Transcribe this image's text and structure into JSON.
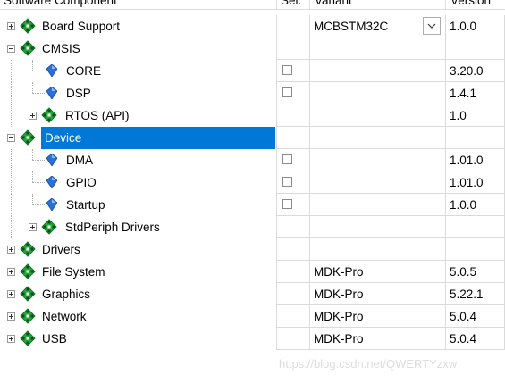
{
  "header": {
    "col_component": "Software Component",
    "col_sel": "Sel.",
    "col_variant": "Variant",
    "col_version": "Version"
  },
  "rows": [
    {
      "label": "Board Support",
      "icon": "green-diamond-icon",
      "expander": "plus",
      "variant": "MCBSTM32C",
      "variant_dropdown": true,
      "version": "1.0.0",
      "checkbox": false
    },
    {
      "label": "CMSIS",
      "icon": "green-diamond-icon",
      "expander": "minus",
      "variant": "",
      "version": "",
      "checkbox": false
    },
    {
      "label": "CORE",
      "icon": "blue-gem-icon",
      "expander": "none",
      "variant": "",
      "version": "3.20.0",
      "checkbox": true
    },
    {
      "label": "DSP",
      "icon": "blue-gem-icon",
      "expander": "none",
      "variant": "",
      "version": "1.4.1",
      "checkbox": true
    },
    {
      "label": "RTOS (API)",
      "icon": "green-diamond-icon",
      "expander": "plus",
      "variant": "",
      "version": "1.0",
      "checkbox": false
    },
    {
      "label": "Device",
      "icon": "green-diamond-icon",
      "expander": "minus",
      "variant": "",
      "version": "",
      "checkbox": false,
      "selected": true
    },
    {
      "label": "DMA",
      "icon": "blue-gem-icon",
      "expander": "none",
      "variant": "",
      "version": "1.01.0",
      "checkbox": true
    },
    {
      "label": "GPIO",
      "icon": "blue-gem-icon",
      "expander": "none",
      "variant": "",
      "version": "1.01.0",
      "checkbox": true
    },
    {
      "label": "Startup",
      "icon": "blue-gem-icon",
      "expander": "none",
      "variant": "",
      "version": "1.0.0",
      "checkbox": true
    },
    {
      "label": "StdPeriph Drivers",
      "icon": "green-diamond-icon",
      "expander": "plus",
      "variant": "",
      "version": "",
      "checkbox": false
    },
    {
      "label": "Drivers",
      "icon": "green-diamond-icon",
      "expander": "plus",
      "variant": "",
      "version": "",
      "checkbox": false
    },
    {
      "label": "File System",
      "icon": "green-diamond-icon",
      "expander": "plus",
      "variant": "MDK-Pro",
      "version": "5.0.5",
      "checkbox": false
    },
    {
      "label": "Graphics",
      "icon": "green-diamond-icon",
      "expander": "plus",
      "variant": "MDK-Pro",
      "version": "5.22.1",
      "checkbox": false
    },
    {
      "label": "Network",
      "icon": "green-diamond-icon",
      "expander": "plus",
      "variant": "MDK-Pro",
      "version": "5.0.4",
      "checkbox": false
    },
    {
      "label": "USB",
      "icon": "green-diamond-icon",
      "expander": "plus",
      "variant": "MDK-Pro",
      "version": "5.0.4",
      "checkbox": false
    }
  ],
  "watermark": "https://blog.csdn.net/QWERTYzxw",
  "colors": {
    "selection": "#0078d7",
    "grid": "#dadada",
    "green_icon": "#22a83a",
    "blue_icon": "#2a6fd6"
  }
}
